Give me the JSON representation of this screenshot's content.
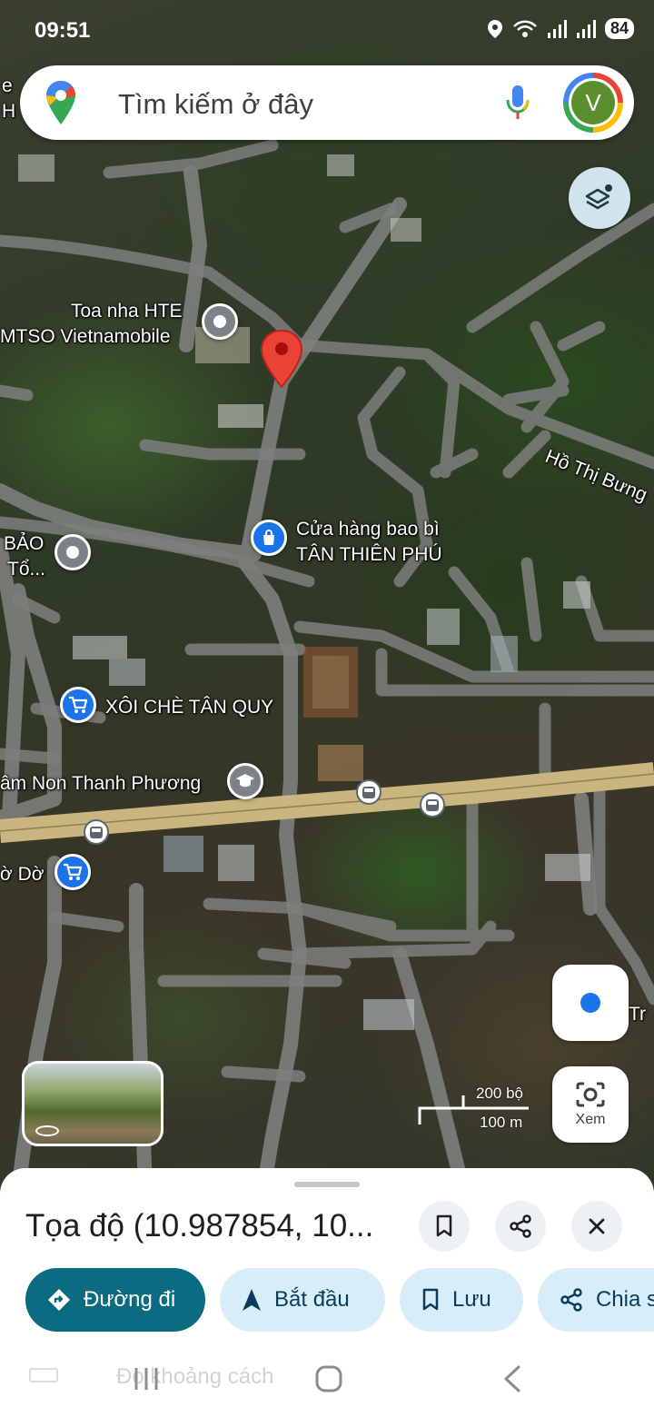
{
  "status_bar": {
    "time": "09:51",
    "battery": "84"
  },
  "search": {
    "placeholder": "Tìm kiếm ở đây",
    "avatar_letter": "V"
  },
  "map": {
    "labels": {
      "toa_nha_1": "Toa nha HTE",
      "toa_nha_2": "MTSO Vietnamobile",
      "cua_hang_1": "Cửa hàng bao bì",
      "cua_hang_2": "TÂN THIÊN PHÚ",
      "xoi_che": "XÔI CHÈ TÂN QUY",
      "mam_non": "âm Non Thanh Phương",
      "bao_to_1": "BẢO",
      "bao_to_2": "Tổ...",
      "ho_thi_bung": "Hồ Thị Bưng",
      "o_do": "ờ Dờ",
      "edge_left_1": "e",
      "edge_left_2": "H",
      "edge_right": "Tr"
    },
    "scale": {
      "feet": "200 bộ",
      "meters": "100 m"
    },
    "lens_label": "Xem"
  },
  "sheet": {
    "title": "Tọa độ (10.987854, 10...",
    "chips": {
      "directions": "Đường đi",
      "start": "Bắt đầu",
      "save": "Lưu",
      "share": "Chia s"
    },
    "ghost_text": "Đo khoảng cách"
  },
  "colors": {
    "accent": "#0b6b80",
    "chip_bg": "#d7eefa",
    "pin": "#ea4335",
    "blue": "#1a73e8"
  }
}
